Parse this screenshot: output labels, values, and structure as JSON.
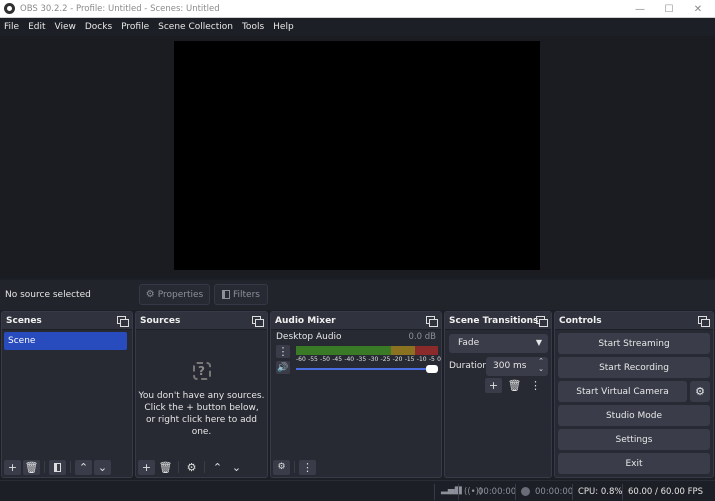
{
  "window": {
    "title": "OBS 30.2.2 - Profile: Untitled - Scenes: Untitled",
    "minimize_icon": "minimize-icon",
    "maximize_icon": "maximize-icon",
    "close_icon": "close-icon"
  },
  "menu": [
    "File",
    "Edit",
    "View",
    "Docks",
    "Profile",
    "Scene Collection",
    "Tools",
    "Help"
  ],
  "source_bar": {
    "status": "No source selected",
    "properties_label": "Properties",
    "filters_label": "Filters"
  },
  "scenes": {
    "title": "Scenes",
    "items": [
      "Scene"
    ],
    "selected": "Scene",
    "accent": "#284bbd"
  },
  "sources": {
    "title": "Sources",
    "empty_lines": [
      "You don't have any sources.",
      "Click the + button below,",
      "or right click here to add one."
    ]
  },
  "audio_mixer": {
    "title": "Audio Mixer",
    "channels": [
      {
        "name": "Desktop Audio",
        "level": "0.0 dB",
        "volume_fraction": 1.0,
        "meter_ticks": [
          "-60",
          "-55",
          "-50",
          "-45",
          "-40",
          "-35",
          "-30",
          "-25",
          "-20",
          "-15",
          "-10",
          "-5",
          "0"
        ]
      }
    ],
    "meter_colors": {
      "green": "#3a7a26",
      "yellow": "#8a7220",
      "red": "#8a2a2a"
    }
  },
  "transitions": {
    "title": "Scene Transitions",
    "selected": "Fade",
    "duration_label": "Duration",
    "duration_value": "300 ms"
  },
  "controls": {
    "title": "Controls",
    "buttons": [
      "Start Streaming",
      "Start Recording",
      "Start Virtual Camera",
      "Studio Mode",
      "Settings",
      "Exit"
    ]
  },
  "status": {
    "stream_time": "00:00:00",
    "record_time": "00:00:00",
    "cpu": "CPU: 0.8%",
    "fps": "60.00 / 60.00 FPS"
  }
}
